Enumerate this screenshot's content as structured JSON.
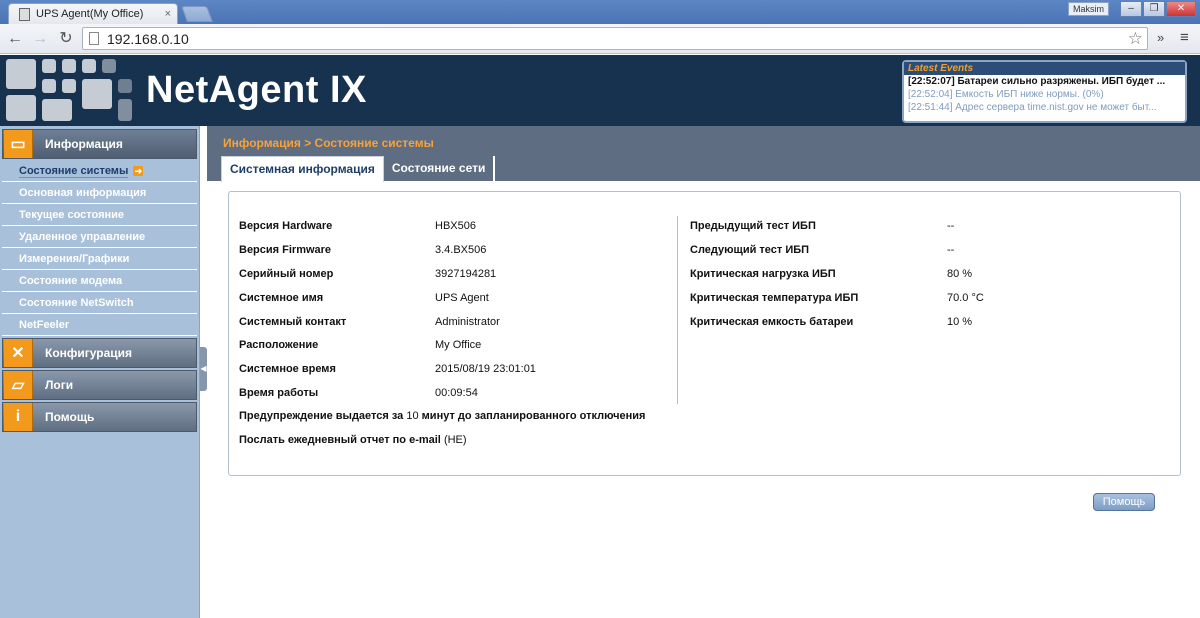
{
  "browser": {
    "tab_title": "UPS Agent(My Office)",
    "tab_close": "×",
    "user": "Maksim",
    "url": "192.168.0.10",
    "minimize": "–",
    "restore": "❐",
    "close": "✕"
  },
  "header": {
    "brand": "NetAgent IX",
    "events_title": "Latest Events",
    "events": [
      "[22:52:07] Батареи сильно разряжены. ИБП будет ...",
      "[22:52:04] Емкость ИБП ниже нормы. (0%)",
      "[22:51:44] Адрес сервера time.nist.gov не может быт..."
    ]
  },
  "sidebar": {
    "sections": [
      {
        "label": "Информация",
        "icon": "monitor-icon"
      },
      {
        "label": "Конфигурация",
        "icon": "tools-icon"
      },
      {
        "label": "Логи",
        "icon": "folder-icon"
      },
      {
        "label": "Помощь",
        "icon": "info-icon"
      }
    ],
    "items": [
      "Состояние системы",
      "Основная информация",
      "Текущее состояние",
      "Удаленное управление",
      "Измерения/Графики",
      "Состояние модема",
      "Состояние NetSwitch",
      "NetFeeler"
    ],
    "selected_index": 0
  },
  "main": {
    "breadcrumb": "Информация > Состояние системы",
    "tabs": [
      "Системная информация",
      "Состояние сети"
    ],
    "left_rows": [
      {
        "key": "Версия Hardware",
        "value": "HBX506"
      },
      {
        "key": "Версия Firmware",
        "value": "3.4.BX506"
      },
      {
        "key": "Серийный номер",
        "value": "3927194281"
      },
      {
        "key": "Системное имя",
        "value": "UPS Agent"
      },
      {
        "key": "Системный контакт",
        "value": "Administrator"
      },
      {
        "key": "Расположение",
        "value": "My Office"
      },
      {
        "key": "Системное время",
        "value": "2015/08/19 23:01:01"
      },
      {
        "key": "Время работы",
        "value": "00:09:54"
      }
    ],
    "right_rows": [
      {
        "key": "Предыдущий тест ИБП",
        "value": "--"
      },
      {
        "key": "Следующий тест ИБП",
        "value": "--"
      },
      {
        "key": "Критическая нагрузка ИБП",
        "value": "80 %"
      },
      {
        "key": "Критическая температура ИБП",
        "value": "70.0 °C"
      },
      {
        "key": "Критическая емкость батареи",
        "value": "10 %"
      }
    ],
    "warning_prefix": "Предупреждение выдается за",
    "warning_minutes": "10",
    "warning_suffix": "минут до запланированного отключения",
    "report_label": "Послать ежедневный отчет по e-mail",
    "report_value": "(НЕ)",
    "help_button": "Помощь"
  },
  "colors": {
    "header_bg": "#17324f",
    "sidebar_bg": "#a8c0da",
    "accent_orange": "#f39a1c",
    "breadcrumb": "#f7a23a"
  }
}
